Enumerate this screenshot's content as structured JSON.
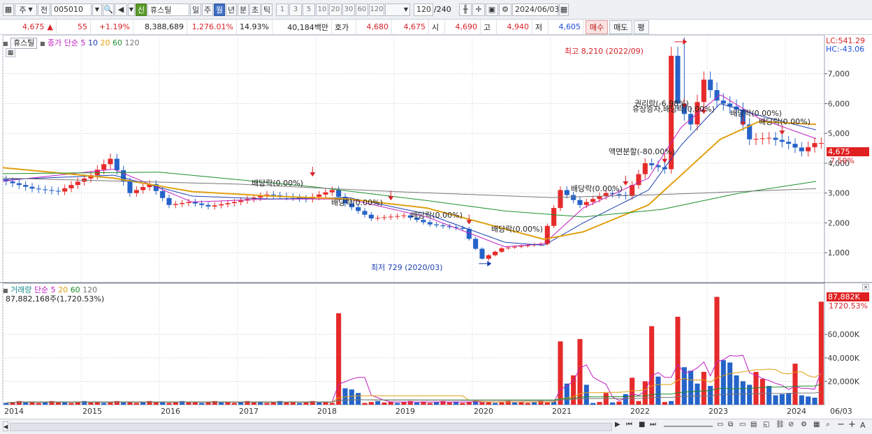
{
  "toolbar": {
    "period_type": "주",
    "prev_label": "전",
    "code": "005010",
    "market_badge": "신",
    "stock_name": "휴스틸",
    "periods": [
      "일",
      "주",
      "월",
      "년",
      "분",
      "초",
      "틱"
    ],
    "active_period": "월",
    "intervals": [
      "1",
      "3",
      "5",
      "10",
      "20",
      "30",
      "60",
      "120"
    ],
    "count": "120",
    "count_total": "/240",
    "date": "2024/06/03"
  },
  "quote": {
    "price": "4,675",
    "change": "55",
    "change_pct": "+1.19%",
    "volume": "8,388,689",
    "volume_pct": "1,276.01%",
    "turnover": "14.93%",
    "amount": "40,184백만",
    "bid_label": "호가",
    "bid": "4,680",
    "ask": "4,675",
    "open_label": "시",
    "open": "4,690",
    "high_label": "고",
    "high": "4,940",
    "low_label": "저",
    "low": "4,605",
    "buy_label": "매수",
    "sell_label": "매도",
    "eval_label": "평"
  },
  "price_panel": {
    "stock_label": "휴스틸",
    "ma_label": "종가 단순 5",
    "ma_periods": [
      "10",
      "20",
      "60",
      "120"
    ],
    "lc": "LC:541.29",
    "hc": "HC:-43.06",
    "current_price": "4,675",
    "current_pct": "7.59%",
    "high_annotation": "최고 8,210 (2022/09)",
    "low_annotation": "최저 729 (2020/03)",
    "events": [
      {
        "label": "배당락(0.00%)",
        "x": "2017/12",
        "y": 3600
      },
      {
        "label": "배당락(0.00%)",
        "x": "2018/12",
        "y": 2800
      },
      {
        "label": "배당락(0.00%)",
        "x": "2019/12",
        "y": 2000
      },
      {
        "label": "배당락(0.00%)",
        "x": "2020/12",
        "y": 1300
      },
      {
        "label": "배당락(0.00%)",
        "x": "2021/12",
        "y": 3300
      },
      {
        "label": "액면분할(-80.00%)",
        "x": "2022/06",
        "y": 4050
      },
      {
        "label": "권리락(-6.98%)",
        "x": "2022/09",
        "y": 5900
      },
      {
        "label": "유상증자,배당락(0.00%)",
        "x": "2022/12",
        "y": 5700
      },
      {
        "label": "배당락(0.00%)",
        "x": "2023/06",
        "y": 5300
      },
      {
        "label": "배당락(0.00%)",
        "x": "2023/12",
        "y": 5000
      }
    ]
  },
  "volume_panel": {
    "label": "거래량",
    "ma_label": "단순 5",
    "ma_periods": [
      "20",
      "60",
      "120"
    ],
    "info": "87,882,168주(1,720.53%)",
    "current_volume": "87,882K",
    "current_pct": "1720.53%"
  },
  "chart_data": [
    {
      "type": "candlestick",
      "title": "",
      "y_ticks": [
        1000,
        2000,
        3000,
        4000,
        5000,
        6000,
        7000
      ],
      "y_tick_labels": [
        "1,000",
        "2,000",
        "3,000",
        "4,000",
        "5,000",
        "6,000",
        "7,000"
      ],
      "ylim": [
        0,
        8300
      ],
      "x_labels": [
        "2014",
        "2015",
        "2016",
        "2017",
        "2018",
        "2019",
        "2020",
        "2021",
        "2022",
        "2023",
        "2024",
        "06/03"
      ],
      "high_point": {
        "date": "2022/09",
        "value": 8210
      },
      "low_point": {
        "date": "2020/03",
        "value": 729
      },
      "last_close": 4675,
      "series": [
        {
          "name": "종가",
          "anchors": [
            {
              "date": "2014/01",
              "value": 3450
            },
            {
              "date": "2014/06",
              "value": 3150
            },
            {
              "date": "2014/10",
              "value": 3050
            },
            {
              "date": "2015/03",
              "value": 3600
            },
            {
              "date": "2015/06",
              "value": 4150
            },
            {
              "date": "2015/09",
              "value": 3000
            },
            {
              "date": "2015/12",
              "value": 3300
            },
            {
              "date": "2016/03",
              "value": 2600
            },
            {
              "date": "2016/06",
              "value": 2700
            },
            {
              "date": "2016/09",
              "value": 2550
            },
            {
              "date": "2017/01",
              "value": 2700
            },
            {
              "date": "2017/06",
              "value": 2950
            },
            {
              "date": "2017/12",
              "value": 2800
            },
            {
              "date": "2018/04",
              "value": 3100
            },
            {
              "date": "2018/06",
              "value": 2650
            },
            {
              "date": "2018/10",
              "value": 2150
            },
            {
              "date": "2019/03",
              "value": 2250
            },
            {
              "date": "2019/07",
              "value": 1950
            },
            {
              "date": "2019/12",
              "value": 1800
            },
            {
              "date": "2020/03",
              "value": 800
            },
            {
              "date": "2020/06",
              "value": 1150
            },
            {
              "date": "2020/12",
              "value": 1300
            },
            {
              "date": "2021/03",
              "value": 3100
            },
            {
              "date": "2021/06",
              "value": 2600
            },
            {
              "date": "2021/10",
              "value": 3000
            },
            {
              "date": "2022/01",
              "value": 2900
            },
            {
              "date": "2022/04",
              "value": 4000
            },
            {
              "date": "2022/07",
              "value": 3800
            },
            {
              "date": "2022/08",
              "value": 7600
            },
            {
              "date": "2022/09",
              "value": 6000
            },
            {
              "date": "2022/11",
              "value": 5300
            },
            {
              "date": "2023/01",
              "value": 6800
            },
            {
              "date": "2023/03",
              "value": 6100
            },
            {
              "date": "2023/06",
              "value": 5800
            },
            {
              "date": "2023/08",
              "value": 4800
            },
            {
              "date": "2023/11",
              "value": 4850
            },
            {
              "date": "2024/02",
              "value": 4650
            },
            {
              "date": "2024/04",
              "value": 4400
            },
            {
              "date": "2024/06",
              "value": 4675
            }
          ]
        },
        {
          "name": "5",
          "anchors": [
            {
              "date": "2014/01",
              "value": 3400
            },
            {
              "date": "2015/06",
              "value": 3800
            },
            {
              "date": "2016/06",
              "value": 2700
            },
            {
              "date": "2017/06",
              "value": 2800
            },
            {
              "date": "2018/06",
              "value": 2800
            },
            {
              "date": "2019/06",
              "value": 2200
            },
            {
              "date": "2020/06",
              "value": 1200
            },
            {
              "date": "2020/12",
              "value": 1300
            },
            {
              "date": "2021/06",
              "value": 2500
            },
            {
              "date": "2022/04",
              "value": 3500
            },
            {
              "date": "2022/09",
              "value": 5200
            },
            {
              "date": "2023/03",
              "value": 6300
            },
            {
              "date": "2023/09",
              "value": 5500
            },
            {
              "date": "2024/06",
              "value": 4800
            }
          ]
        },
        {
          "name": "10",
          "anchors": [
            {
              "date": "2014/01",
              "value": 3450
            },
            {
              "date": "2015/06",
              "value": 3600
            },
            {
              "date": "2016/06",
              "value": 2900
            },
            {
              "date": "2017/06",
              "value": 2800
            },
            {
              "date": "2018/06",
              "value": 2850
            },
            {
              "date": "2019/06",
              "value": 2300
            },
            {
              "date": "2020/06",
              "value": 1350
            },
            {
              "date": "2020/12",
              "value": 1250
            },
            {
              "date": "2021/06",
              "value": 2000
            },
            {
              "date": "2022/04",
              "value": 3100
            },
            {
              "date": "2022/09",
              "value": 4600
            },
            {
              "date": "2023/03",
              "value": 6000
            },
            {
              "date": "2023/09",
              "value": 5600
            },
            {
              "date": "2024/06",
              "value": 5100
            }
          ]
        },
        {
          "name": "20",
          "anchors": [
            {
              "date": "2014/01",
              "value": 3850
            },
            {
              "date": "2015/06",
              "value": 3500
            },
            {
              "date": "2016/06",
              "value": 3050
            },
            {
              "date": "2017/06",
              "value": 2900
            },
            {
              "date": "2018/06",
              "value": 2800
            },
            {
              "date": "2019/06",
              "value": 2500
            },
            {
              "date": "2020/06",
              "value": 1800
            },
            {
              "date": "2020/12",
              "value": 1450
            },
            {
              "date": "2021/06",
              "value": 1700
            },
            {
              "date": "2022/04",
              "value": 2600
            },
            {
              "date": "2022/09",
              "value": 3600
            },
            {
              "date": "2023/03",
              "value": 4800
            },
            {
              "date": "2023/09",
              "value": 5400
            },
            {
              "date": "2024/06",
              "value": 5300
            }
          ]
        },
        {
          "name": "60",
          "anchors": [
            {
              "date": "2014/01",
              "value": 3650
            },
            {
              "date": "2016/01",
              "value": 3700
            },
            {
              "date": "2018/01",
              "value": 3200
            },
            {
              "date": "2019/06",
              "value": 2750
            },
            {
              "date": "2020/06",
              "value": 2400
            },
            {
              "date": "2021/06",
              "value": 2200
            },
            {
              "date": "2022/06",
              "value": 2450
            },
            {
              "date": "2023/06",
              "value": 3000
            },
            {
              "date": "2024/06",
              "value": 3400
            }
          ]
        },
        {
          "name": "120",
          "anchors": [
            {
              "date": "2014/01",
              "value": 3500
            },
            {
              "date": "2017/01",
              "value": 3300
            },
            {
              "date": "2019/01",
              "value": 3050
            },
            {
              "date": "2021/01",
              "value": 2850
            },
            {
              "date": "2022/06",
              "value": 2950
            },
            {
              "date": "2024/06",
              "value": 3150
            }
          ]
        }
      ]
    },
    {
      "type": "bar",
      "title": "",
      "y_ticks": [
        20000,
        40000,
        60000
      ],
      "y_tick_labels": [
        "20,000K",
        "40,000K",
        "60,000K"
      ],
      "unit": "K",
      "x_labels": [
        "2014",
        "2015",
        "2016",
        "2017",
        "2018",
        "2019",
        "2020",
        "2021",
        "2022",
        "2023",
        "2024",
        "06/03"
      ],
      "bars": [
        {
          "date": "2018/04",
          "value": 78000,
          "up": true
        },
        {
          "date": "2018/05",
          "value": 14000,
          "up": false
        },
        {
          "date": "2018/06",
          "value": 13000,
          "up": false
        },
        {
          "date": "2018/07",
          "value": 10000,
          "up": false
        },
        {
          "date": "2021/02",
          "value": 54000,
          "up": true
        },
        {
          "date": "2021/03",
          "value": 18000,
          "up": false
        },
        {
          "date": "2021/04",
          "value": 25000,
          "up": true
        },
        {
          "date": "2021/05",
          "value": 56000,
          "up": true
        },
        {
          "date": "2021/06",
          "value": 17000,
          "up": false
        },
        {
          "date": "2021/09",
          "value": 10000,
          "up": true
        },
        {
          "date": "2021/12",
          "value": 9000,
          "up": false
        },
        {
          "date": "2022/01",
          "value": 23000,
          "up": true
        },
        {
          "date": "2022/03",
          "value": 20000,
          "up": true
        },
        {
          "date": "2022/04",
          "value": 67000,
          "up": true
        },
        {
          "date": "2022/05",
          "value": 24000,
          "up": false
        },
        {
          "date": "2022/08",
          "value": 75000,
          "up": true
        },
        {
          "date": "2022/09",
          "value": 32000,
          "up": false
        },
        {
          "date": "2022/10",
          "value": 29000,
          "up": false
        },
        {
          "date": "2022/11",
          "value": 18000,
          "up": false
        },
        {
          "date": "2022/12",
          "value": 28000,
          "up": true
        },
        {
          "date": "2023/01",
          "value": 16000,
          "up": false
        },
        {
          "date": "2023/02",
          "value": 92000,
          "up": true
        },
        {
          "date": "2023/03",
          "value": 38000,
          "up": false
        },
        {
          "date": "2023/04",
          "value": 36000,
          "up": false
        },
        {
          "date": "2023/05",
          "value": 25000,
          "up": false
        },
        {
          "date": "2023/06",
          "value": 20000,
          "up": false
        },
        {
          "date": "2023/07",
          "value": 17000,
          "up": false
        },
        {
          "date": "2023/08",
          "value": 28000,
          "up": true
        },
        {
          "date": "2023/09",
          "value": 22000,
          "up": true
        },
        {
          "date": "2023/10",
          "value": 16000,
          "up": false
        },
        {
          "date": "2023/11",
          "value": 8000,
          "up": false
        },
        {
          "date": "2023/12",
          "value": 9000,
          "up": false
        },
        {
          "date": "2024/01",
          "value": 10000,
          "up": false
        },
        {
          "date": "2024/02",
          "value": 35000,
          "up": true
        },
        {
          "date": "2024/03",
          "value": 8000,
          "up": false
        },
        {
          "date": "2024/04",
          "value": 7000,
          "up": false
        },
        {
          "date": "2024/05",
          "value": 6000,
          "up": false
        },
        {
          "date": "2024/06",
          "value": 87882,
          "up": true
        }
      ]
    }
  ]
}
